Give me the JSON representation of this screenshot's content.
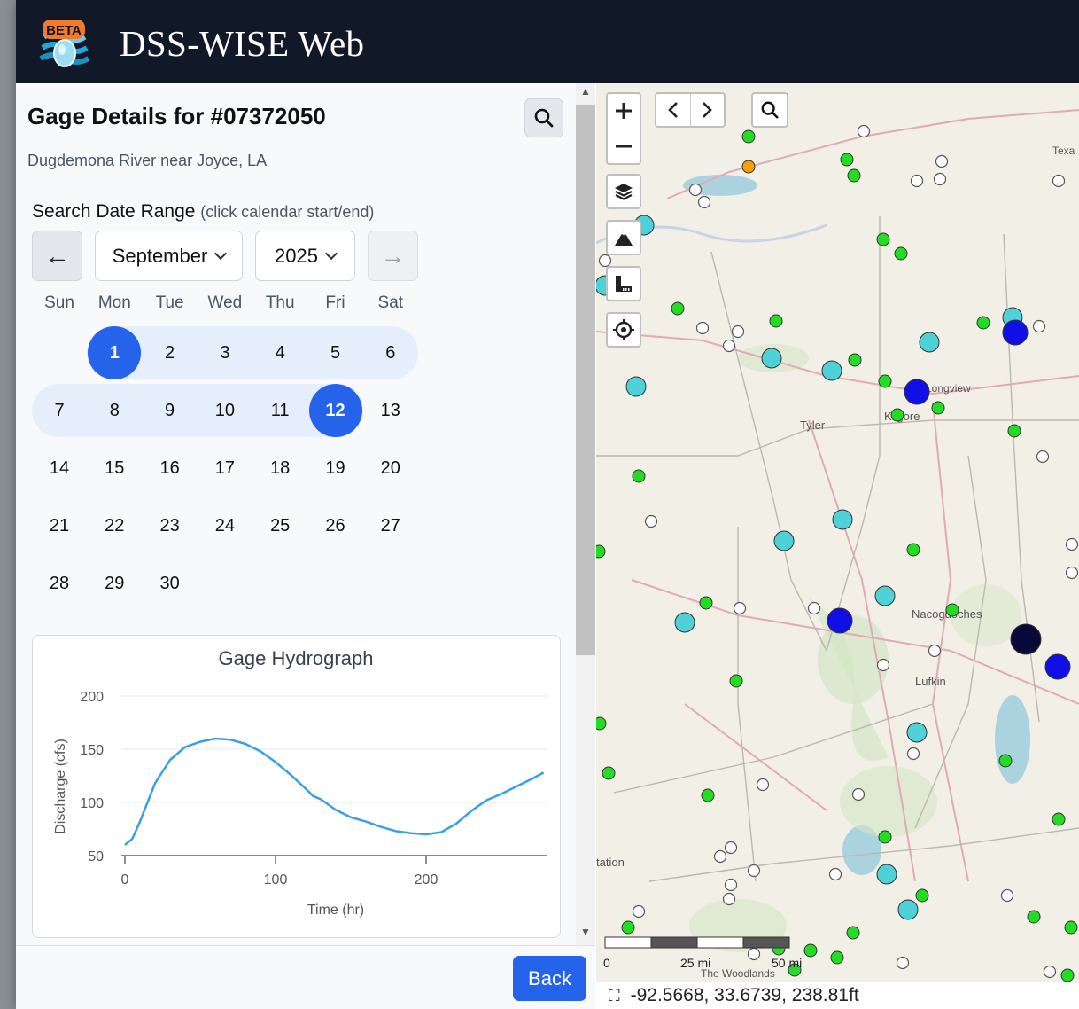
{
  "app": {
    "badge": "BETA",
    "title": "DSS-WISE Web"
  },
  "panel": {
    "title": "Gage Details for #07372050",
    "subtitle": "Dugdemona River near Joyce, LA",
    "range_label": "Search Date Range",
    "range_hint": "(click calendar start/end)"
  },
  "calendar": {
    "month": "September",
    "year": "2025",
    "prev_label": "←",
    "next_label": "→",
    "weekdays": [
      "Sun",
      "Mon",
      "Tue",
      "Wed",
      "Thu",
      "Fri",
      "Sat"
    ],
    "weeks": [
      [
        "",
        "1",
        "2",
        "3",
        "4",
        "5",
        "6"
      ],
      [
        "7",
        "8",
        "9",
        "10",
        "11",
        "12",
        "13"
      ],
      [
        "14",
        "15",
        "16",
        "17",
        "18",
        "19",
        "20"
      ],
      [
        "21",
        "22",
        "23",
        "24",
        "25",
        "26",
        "27"
      ],
      [
        "28",
        "29",
        "30",
        "",
        "",
        "",
        ""
      ]
    ],
    "range_start": 1,
    "range_end": 12,
    "selected_color": "#2563eb",
    "range_color": "#e6eefb"
  },
  "chart_data": {
    "type": "line",
    "title": "Gage Hydrograph",
    "xlabel": "Time (hr)",
    "ylabel": "Discharge (cfs)",
    "xlim": [
      0,
      280
    ],
    "ylim": [
      50,
      200
    ],
    "xticks": [
      "0",
      "100",
      "200"
    ],
    "yticks": [
      "50",
      "100",
      "150",
      "200"
    ],
    "grid": true,
    "line_color": "#3b9fe6",
    "series": [
      {
        "x": [
          0,
          5,
          10,
          20,
          30,
          40,
          50,
          60,
          70,
          80,
          90,
          100,
          110,
          120,
          125,
          130,
          135,
          140,
          150,
          160,
          170,
          180,
          190,
          200,
          210,
          220,
          230,
          240,
          250,
          260,
          270,
          278
        ],
        "values": [
          60,
          66,
          82,
          118,
          140,
          152,
          157,
          160,
          159,
          155,
          148,
          138,
          126,
          113,
          106,
          103,
          98,
          93,
          86,
          82,
          77,
          73,
          71,
          70,
          72,
          80,
          92,
          102,
          108,
          115,
          122,
          128
        ]
      }
    ]
  },
  "footer": {
    "back_label": "Back"
  },
  "map": {
    "place_labels": [
      "Tyler",
      "Kilgore",
      "Longview",
      "Nacogdoches",
      "Lufkin",
      "Texa",
      "tation",
      "The Woodlands"
    ],
    "scale_labels": [
      "0",
      "25 mi",
      "50 mi"
    ],
    "coordinates": "-92.5668, 33.6739, 238.81ft",
    "colors": {
      "green": "#22dd22",
      "cyan": "#4fd1d9",
      "blue": "#1010e6",
      "navy": "#0a0a3a",
      "orange": "#f59e0b",
      "white": "#ffffff"
    }
  }
}
